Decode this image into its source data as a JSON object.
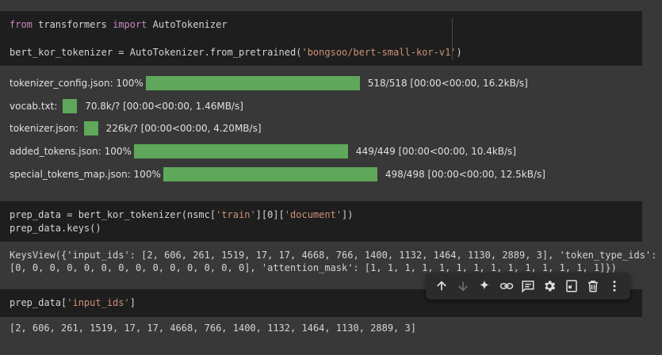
{
  "cell1": {
    "line1_kw1": "from",
    "line1_mod": " transformers ",
    "line1_kw2": "import",
    "line1_name": " AutoTokenizer",
    "line2_pre": "bert_kor_tokenizer = AutoTokenizer.from_pretrained(",
    "line2_str": "'bongsoo/bert-small-kor-v1'",
    "line2_post": ")"
  },
  "progress": [
    {
      "label": "tokenizer_config.json: 100%",
      "fraction": 1.0,
      "stats": "518/518 [00:00<00:00, 16.2kB/s]"
    },
    {
      "label": "vocab.txt: ",
      "fraction": null,
      "stats": "70.8k/? [00:00<00:00, 1.46MB/s]"
    },
    {
      "label": "tokenizer.json: ",
      "fraction": null,
      "stats": "226k/? [00:00<00:00, 4.20MB/s]"
    },
    {
      "label": "added_tokens.json: 100%",
      "fraction": 1.0,
      "stats": "449/449 [00:00<00:00, 10.4kB/s]"
    },
    {
      "label": "special_tokens_map.json: 100%",
      "fraction": 1.0,
      "stats": "498/498 [00:00<00:00, 12.5kB/s]"
    }
  ],
  "cell2": {
    "line1_pre": "prep_data = bert_kor_tokenizer(nsmc[",
    "line1_s1": "'train'",
    "line1_mid": "][0][",
    "line1_s2": "'document'",
    "line1_post": "])",
    "line2": "prep_data.keys()"
  },
  "output2": {
    "line1": "KeysView({'input_ids': [2, 606, 261, 1519, 17, 17, 4668, 766, 1400, 1132, 1464, 1130, 2889, 3], 'token_type_ids':",
    "line2": "[0, 0, 0, 0, 0, 0, 0, 0, 0, 0, 0, 0, 0, 0], 'attention_mask': [1, 1, 1, 1, 1, 1, 1, 1, 1, 1, 1, 1, 1, 1]})"
  },
  "cell3": {
    "pre": "prep_data[",
    "str": "'input_ids'",
    "post": "]"
  },
  "output3": "[2, 606, 261, 1519, 17, 17, 4668, 766, 1400, 1132, 1464, 1130, 2889, 3]",
  "toolbar_icons": [
    "arrow-up-icon",
    "arrow-down-icon",
    "sparkle-icon",
    "link-icon",
    "comment-icon",
    "gear-icon",
    "split-icon",
    "trash-icon",
    "more-vertical-icon"
  ],
  "colors": {
    "progress_bar": "#5fa75a",
    "keyword": "#c586c0",
    "string": "#ce9178",
    "cell_bg": "#1e1e1e",
    "page_bg": "#383838"
  }
}
